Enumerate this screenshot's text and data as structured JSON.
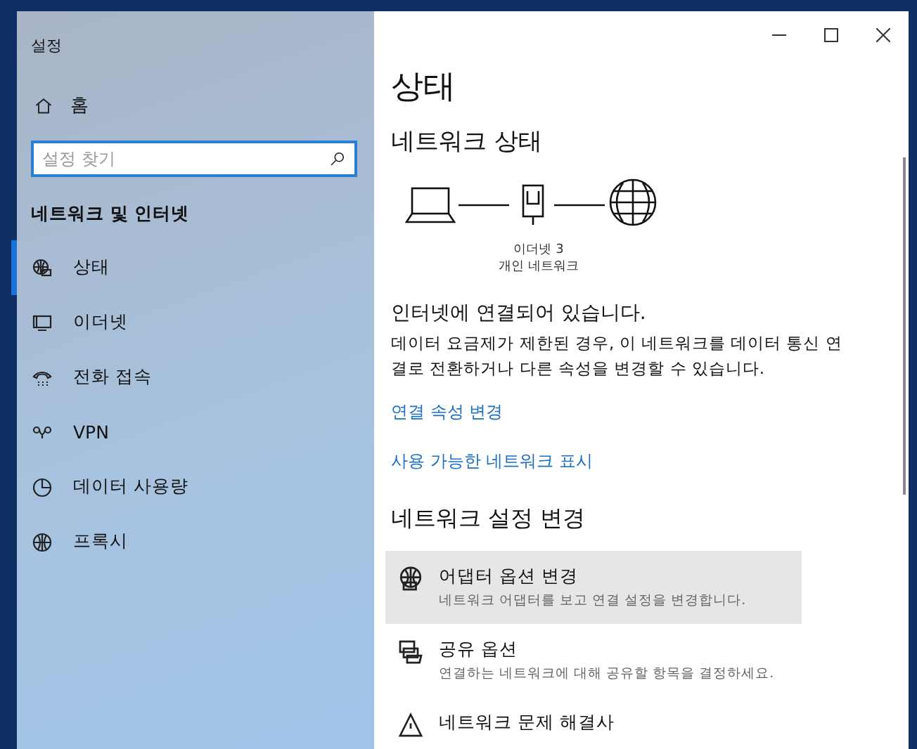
{
  "window": {
    "title": "설정",
    "controls": [
      {
        "kind": "minimize"
      },
      {
        "kind": "maximize"
      },
      {
        "kind": "close"
      }
    ]
  },
  "sidebar": {
    "home": {
      "label": "홈"
    },
    "search": {
      "placeholder": "설정 찾기"
    },
    "section_title": "네트워크 및 인터넷",
    "items": [
      {
        "label": "상태",
        "kind": "status",
        "selected": true
      },
      {
        "label": "이더넷",
        "kind": "ethernet",
        "selected": false
      },
      {
        "label": "전화 접속",
        "kind": "dialup",
        "selected": false
      },
      {
        "label": "VPN",
        "kind": "vpn",
        "selected": false
      },
      {
        "label": "데이터 사용량",
        "kind": "data",
        "selected": false
      },
      {
        "label": "프록시",
        "kind": "proxy",
        "selected": false
      }
    ]
  },
  "page": {
    "title": "상태",
    "network_status": {
      "heading": "네트워크 상태",
      "adapter_name": "이더넷 3",
      "network_type": "개인 네트워크"
    },
    "connection_message": "인터넷에 연결되어 있습니다.",
    "description": "데이터 요금제가 제한된 경우, 이 네트워크를 데이터 통신 연결로 전환하거나 다른 속성을 변경할 수 있습니다.",
    "links": [
      "연결 속성 변경",
      "사용 가능한 네트워크 표시"
    ],
    "settings_heading": "네트워크 설정 변경",
    "settings": [
      {
        "kind": "adapter",
        "title": "어댑터 옵션 변경",
        "description": "네트워크 어댑터를 보고 연결 설정을 변경합니다.",
        "hovered": true
      },
      {
        "kind": "sharing",
        "title": "공유 옵션",
        "description": "연결하는 네트워크에 대해 공유할 항목을 결정하세요.",
        "hovered": false
      },
      {
        "kind": "troubleshoot",
        "title": "네트워크 문제 해결사",
        "hovered": false
      }
    ]
  }
}
